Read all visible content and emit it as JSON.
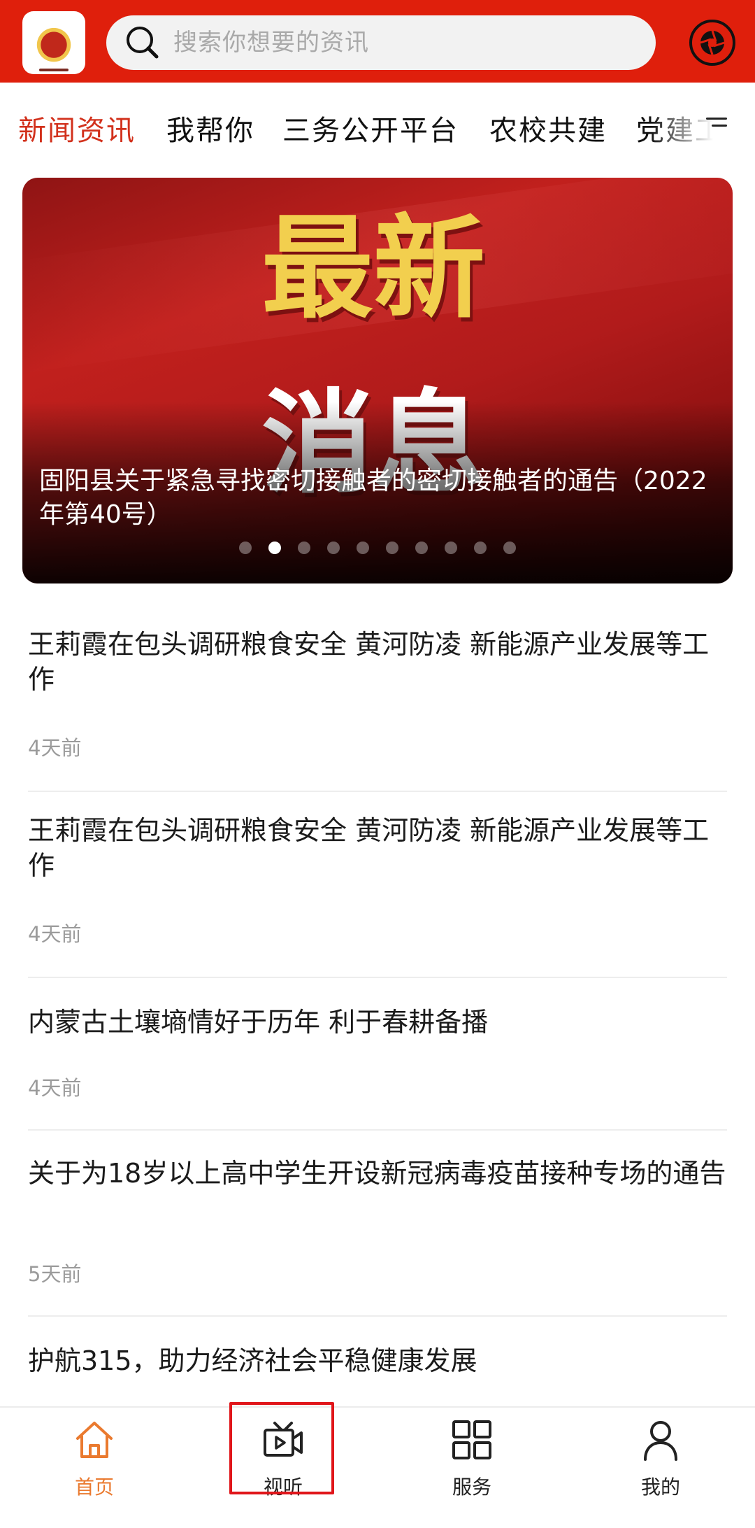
{
  "header": {
    "search_placeholder": "搜索你想要的资讯",
    "logo_icon": "app-logo-icon",
    "camera_icon": "camera-aperture-icon",
    "brand_color": "#df1f0c"
  },
  "tabs": {
    "items": [
      "新闻资讯",
      "我帮你",
      "三务公开平台",
      "农校共建",
      "党建工"
    ],
    "active_index": 0,
    "menu_icon": "menu-icon"
  },
  "banner": {
    "big_text_1": "最新",
    "big_text_2": "消息",
    "caption": "固阳县关于紧急寻找密切接触者的密切接触者的通告（2022年第40号）",
    "slide_count": 10,
    "active_slide": 1
  },
  "news": [
    {
      "title": "王莉霞在包头调研粮食安全 黄河防凌 新能源产业发展等工作",
      "time": "4天前"
    },
    {
      "title": "王莉霞在包头调研粮食安全 黄河防凌 新能源产业发展等工作",
      "time": "4天前"
    },
    {
      "title": "内蒙古土壤墒情好于历年 利于春耕备播",
      "time": "4天前"
    },
    {
      "title": "关于为18岁以上高中学生开设新冠病毒疫苗接种专场的通告",
      "time": "5天前"
    },
    {
      "title": "护航315，助力经济社会平稳健康发展",
      "time": ""
    }
  ],
  "bottom_nav": {
    "items": [
      {
        "label": "首页",
        "icon": "home-icon"
      },
      {
        "label": "视听",
        "icon": "video-tv-icon"
      },
      {
        "label": "服务",
        "icon": "grid-apps-icon"
      },
      {
        "label": "我的",
        "icon": "user-icon"
      }
    ],
    "active_index": 0,
    "active_color": "#ea7a2f"
  }
}
